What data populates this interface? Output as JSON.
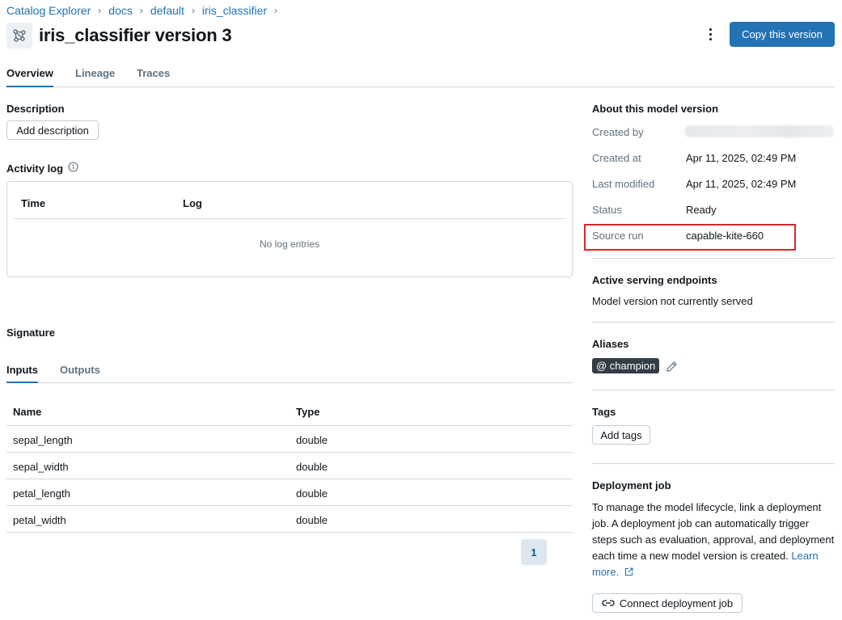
{
  "breadcrumb": [
    "Catalog Explorer",
    "docs",
    "default",
    "iris_classifier"
  ],
  "header": {
    "title": "iris_classifier version 3",
    "copy_button": "Copy this version"
  },
  "tabs": [
    "Overview",
    "Lineage",
    "Traces"
  ],
  "description": {
    "title": "Description",
    "add_button": "Add description"
  },
  "activity_log": {
    "title": "Activity log",
    "columns": [
      "Time",
      "Log"
    ],
    "empty": "No log entries"
  },
  "signature": {
    "title": "Signature",
    "tabs": [
      "Inputs",
      "Outputs"
    ],
    "columns": [
      "Name",
      "Type"
    ],
    "rows": [
      {
        "name": "sepal_length",
        "type": "double"
      },
      {
        "name": "sepal_width",
        "type": "double"
      },
      {
        "name": "petal_length",
        "type": "double"
      },
      {
        "name": "petal_width",
        "type": "double"
      }
    ],
    "page": "1"
  },
  "about": {
    "title": "About this model version",
    "created_by_label": "Created by",
    "created_at_label": "Created at",
    "created_at": "Apr 11, 2025, 02:49 PM",
    "last_modified_label": "Last modified",
    "last_modified": "Apr 11, 2025, 02:49 PM",
    "status_label": "Status",
    "status": "Ready",
    "source_run_label": "Source run",
    "source_run": "capable-kite-660"
  },
  "serving": {
    "title": "Active serving endpoints",
    "text": "Model version not currently served"
  },
  "aliases": {
    "title": "Aliases",
    "items": [
      "@ champion"
    ]
  },
  "tags": {
    "title": "Tags",
    "add_button": "Add tags"
  },
  "deployment": {
    "title": "Deployment job",
    "text": "To manage the model lifecycle, link a deployment job. A deployment job can automatically trigger steps such as evaluation, approval, and deployment each time a new model version is created.",
    "learn_more": "Learn more.",
    "connect_button": "Connect deployment job"
  },
  "colors": {
    "primary": "#2272b4",
    "highlight": "#d9262c",
    "badge": "#343c45"
  }
}
